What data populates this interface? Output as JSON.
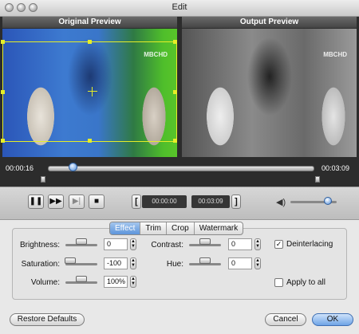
{
  "window": {
    "title": "Edit"
  },
  "preview": {
    "original_label": "Original Preview",
    "output_label": "Output Preview",
    "watermark": "MBCHD"
  },
  "timeline": {
    "current_time": "00:00:16",
    "total_time": "00:03:09",
    "position_fraction": 0.085
  },
  "toolbar": {
    "start_time": "00:00:00",
    "end_time": "00:03:09",
    "left_bracket": "[",
    "right_bracket": "]",
    "pause_glyph": "❚❚",
    "forward_glyph": "▶▶",
    "frame_glyph": "▶|",
    "stop_glyph": "■",
    "volume_icon": "speaker-icon",
    "volume_fraction": 0.75
  },
  "tabs": [
    {
      "label": "Effect",
      "active": true
    },
    {
      "label": "Trim",
      "active": false
    },
    {
      "label": "Crop",
      "active": false
    },
    {
      "label": "Watermark",
      "active": false
    }
  ],
  "effect": {
    "brightness": {
      "label": "Brightness:",
      "value": "0"
    },
    "saturation": {
      "label": "Saturation:",
      "value": "-100"
    },
    "volume": {
      "label": "Volume:",
      "value": "100%"
    },
    "contrast": {
      "label": "Contrast:",
      "value": "0"
    },
    "hue": {
      "label": "Hue:",
      "value": "0"
    },
    "deinterlacing": {
      "label": "Deinterlacing",
      "checked": true
    },
    "apply_all": {
      "label": "Apply to all",
      "checked": false
    }
  },
  "buttons": {
    "restore": "Restore Defaults",
    "cancel": "Cancel",
    "ok": "OK"
  }
}
